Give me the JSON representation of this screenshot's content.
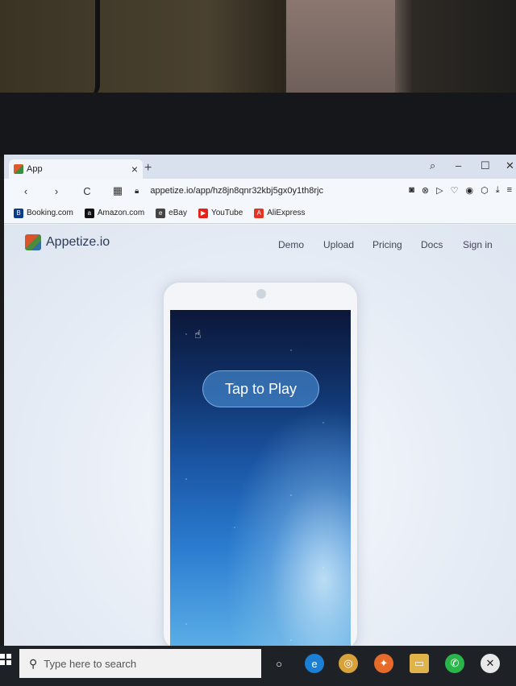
{
  "browser": {
    "tab": {
      "title": "App"
    },
    "new_tab_glyph": "+",
    "url": "appetize.io/app/hz8jn8qnr32kbj5gx0y1th8rjc",
    "bookmarks": [
      {
        "label": "Booking.com",
        "icon_letter": "B",
        "color": "#0b3b8c"
      },
      {
        "label": "Amazon.com",
        "icon_letter": "a",
        "color": "#111111"
      },
      {
        "label": "eBay",
        "icon_letter": "e",
        "color": "#444444"
      },
      {
        "label": "YouTube",
        "icon_letter": "▶",
        "color": "#e62117"
      },
      {
        "label": "AliExpress",
        "icon_letter": "A",
        "color": "#e43225"
      }
    ]
  },
  "site": {
    "brand": "Appetize.io",
    "nav": {
      "demo": "Demo",
      "upload": "Upload",
      "pricing": "Pricing",
      "docs": "Docs",
      "signin": "Sign in"
    }
  },
  "app": {
    "play_label": "Tap to Play"
  },
  "taskbar": {
    "search_placeholder": "Type here to search"
  },
  "colors": {
    "accent": "#2a7bcf",
    "taskbar": "#1e2126"
  }
}
